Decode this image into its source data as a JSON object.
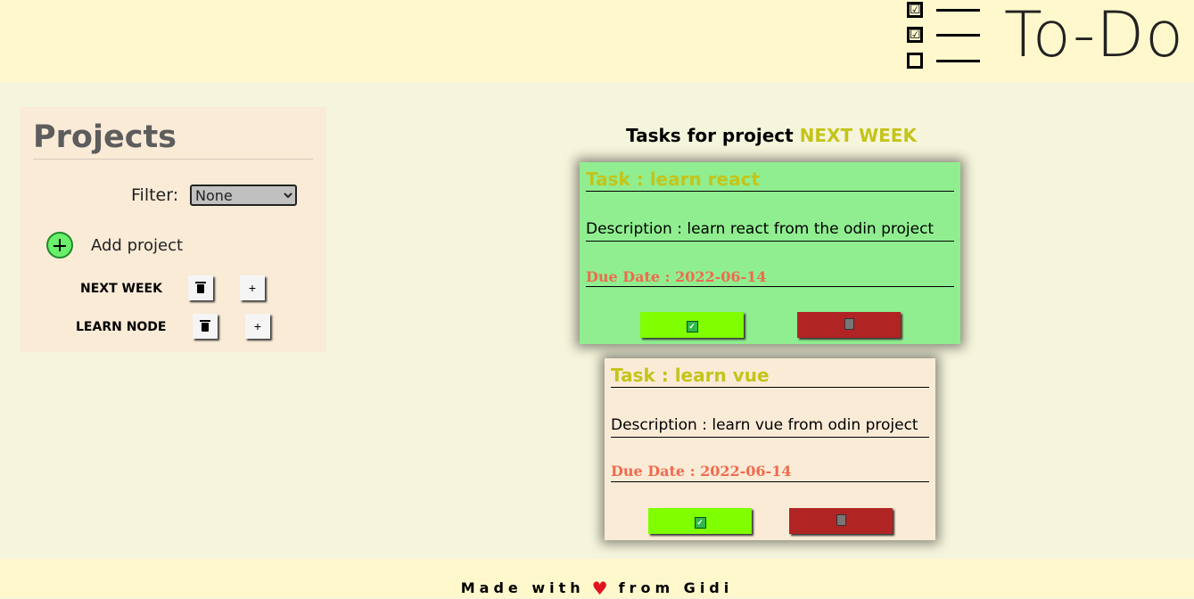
{
  "header": {
    "app_title": "To-Do",
    "logo_icon": "checklist-icon",
    "logo_rows": [
      "☑",
      "☑",
      ""
    ]
  },
  "sidebar": {
    "title": "Projects",
    "filter_label": "Filter:",
    "filter_selected": "None",
    "add_label": "Add project",
    "projects": [
      {
        "name": "NEXT WEEK",
        "delete_icon": "trash-icon",
        "add_icon": "plus-icon",
        "add_symbol": "+"
      },
      {
        "name": "LEARN NODE",
        "delete_icon": "trash-icon",
        "add_icon": "plus-icon",
        "add_symbol": "+"
      }
    ]
  },
  "main": {
    "heading_prefix": "Tasks for project",
    "heading_project": "NEXT WEEK",
    "tasks": [
      {
        "title": "Task : learn react",
        "description": "Description : learn react from the odin project",
        "due": "Due Date : 2022-06-14",
        "background": "#90ee90",
        "done_icon": "check-icon",
        "delete_icon": "trash-icon"
      },
      {
        "title": "Task : learn vue",
        "description": "Description : learn vue from odin project",
        "due": "Due Date : 2022-06-14",
        "background": "#faebd7",
        "done_icon": "check-icon",
        "delete_icon": "trash-icon"
      }
    ]
  },
  "footer": {
    "prefix": "Made with",
    "suffix": "from Gidi",
    "heart_icon": "heart-icon",
    "heart_glyph": "♥"
  },
  "colors": {
    "accent": "#c4c41a",
    "header_bg": "#fff8cc",
    "page_bg": "#f5f5dc",
    "done_button": "#7fff00",
    "delete_button": "#b02424",
    "due_date": "#f06a4d"
  }
}
